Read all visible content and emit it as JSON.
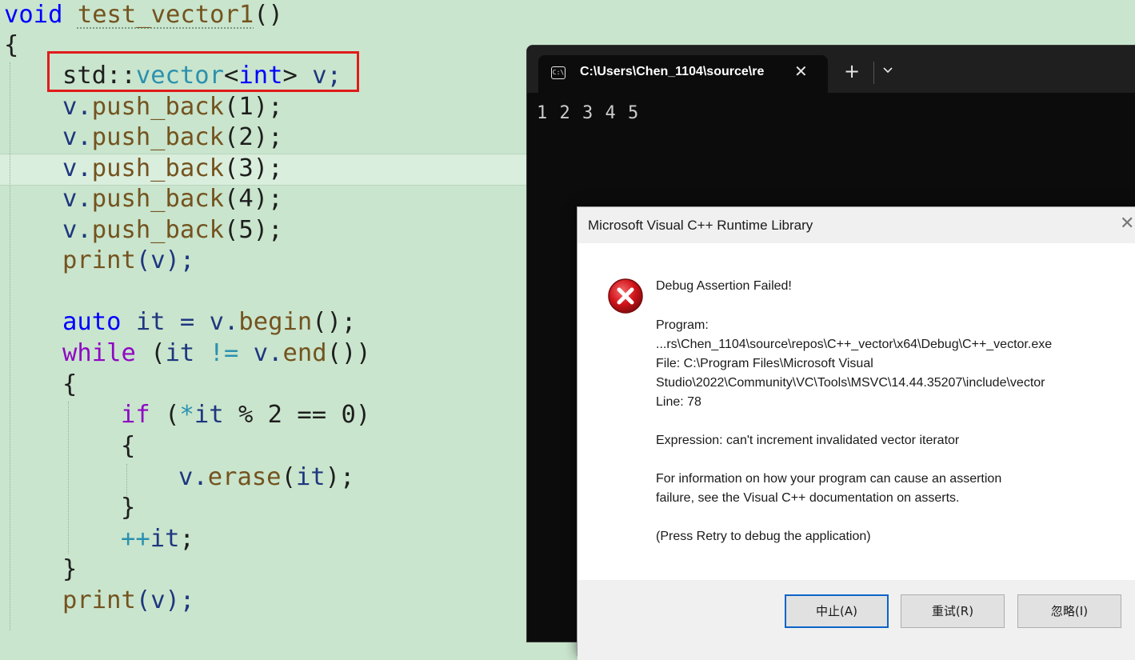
{
  "editor": {
    "lines": [
      [
        "void",
        " ",
        "test_vector1",
        "()"
      ],
      [
        "{"
      ],
      [
        "std",
        "::",
        "vector",
        "<",
        "int",
        ">",
        " v;"
      ],
      [
        "v.",
        "push_back",
        "(1);"
      ],
      [
        "v.",
        "push_back",
        "(2);"
      ],
      [
        "v.",
        "push_back",
        "(3);"
      ],
      [
        "v.",
        "push_back",
        "(4);"
      ],
      [
        "v.",
        "push_back",
        "(5);"
      ],
      [
        "print",
        "(v);"
      ],
      [
        ""
      ],
      [
        "auto",
        " it = ",
        "v.",
        "begin",
        "();"
      ],
      [
        "while",
        " (",
        "it",
        " != ",
        "v.",
        "end",
        "())"
      ],
      [
        "{"
      ],
      [
        "if",
        " (",
        "*",
        "it",
        " % 2 == 0)"
      ],
      [
        "{"
      ],
      [
        "v.",
        "erase",
        "(",
        "it",
        ");"
      ],
      [
        "}"
      ],
      [
        "++",
        "it",
        ";"
      ],
      [
        "}"
      ],
      [
        "print",
        "(v);"
      ]
    ]
  },
  "terminal": {
    "tab_title": "C:\\Users\\Chen_1104\\source\\re",
    "tab_icon": "terminal-icon",
    "close_glyph": "✕",
    "new_tab_glyph": "+",
    "output": "1 2 3 4 5"
  },
  "dialog": {
    "title": "Microsoft Visual C++ Runtime Library",
    "close_glyph": "✕",
    "icon": "error-icon",
    "heading": "Debug Assertion Failed!",
    "program_label": "Program:",
    "program_path": "...rs\\Chen_1104\\source\\repos\\C++_vector\\x64\\Debug\\C++_vector.exe",
    "file_line1": "File: C:\\Program Files\\Microsoft Visual",
    "file_line2": "Studio\\2022\\Community\\VC\\Tools\\MSVC\\14.44.35207\\include\\vector",
    "line_info": "Line: 78",
    "expression": "Expression: can't increment invalidated vector iterator",
    "info1": "For information on how your program can cause an assertion",
    "info2": "failure, see the Visual C++ documentation on asserts.",
    "press_retry": "(Press Retry to debug the application)",
    "buttons": {
      "abort": "中止(A)",
      "retry": "重试(R)",
      "ignore": "忽略(I)"
    }
  },
  "colors": {
    "editor_bg": "#c9e5cd",
    "keyword": "#0000ff",
    "function": "#74531f",
    "type": "#2b91af",
    "control": "#8f08c4",
    "highlight_box": "#e11b1b"
  }
}
